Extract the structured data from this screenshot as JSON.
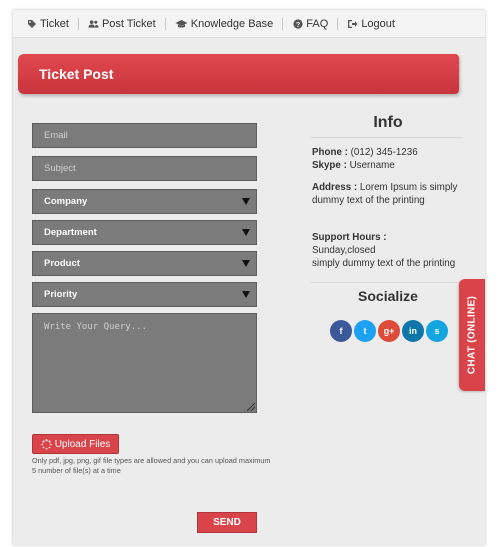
{
  "nav": {
    "items": [
      {
        "label": "Ticket",
        "icon": "tag-icon"
      },
      {
        "label": "Post Ticket",
        "icon": "users-icon"
      },
      {
        "label": "Knowledge Base",
        "icon": "graduation-cap-icon"
      },
      {
        "label": "FAQ",
        "icon": "question-circle-icon"
      },
      {
        "label": "Logout",
        "icon": "sign-out-icon"
      }
    ]
  },
  "header": {
    "title": "Ticket Post"
  },
  "form": {
    "email_placeholder": "Email",
    "subject_placeholder": "Subject",
    "company_selected": "Company",
    "department_selected": "Department",
    "product_selected": "Product",
    "priority_selected": "Priority",
    "query_placeholder": "Write Your Query...",
    "upload_label": "Upload Files",
    "upload_note": "Only pdf, jpg, png, gif file types are allowed and you can upload maximum 5 number of file(s) at a time",
    "send_label": "SEND"
  },
  "info": {
    "title": "Info",
    "phone_label": "Phone :",
    "phone_value": "(012) 345-1236",
    "skype_label": "Skype :",
    "skype_value": "Username",
    "address_label": "Address :",
    "address_value": "Lorem Ipsum is simply dummy text of the printing",
    "support_label": "Support Hours :",
    "support_line1": "Sunday,closed",
    "support_line2": "simply dummy text of the printing"
  },
  "social": {
    "title": "Socialize",
    "items": [
      {
        "icon": "facebook-icon",
        "glyph": "f",
        "color": "#3b5998"
      },
      {
        "icon": "twitter-icon",
        "glyph": "t",
        "color": "#1da1f2"
      },
      {
        "icon": "google-plus-icon",
        "glyph": "g+",
        "color": "#dd4b39"
      },
      {
        "icon": "linkedin-icon",
        "glyph": "in",
        "color": "#0e76a8"
      },
      {
        "icon": "skype-icon",
        "glyph": "s",
        "color": "#12a5e0"
      }
    ]
  },
  "chat": {
    "label": "CHAT (ONLINE)"
  },
  "colors": {
    "accent": "#d9444a",
    "field": "#7b7b7b"
  }
}
